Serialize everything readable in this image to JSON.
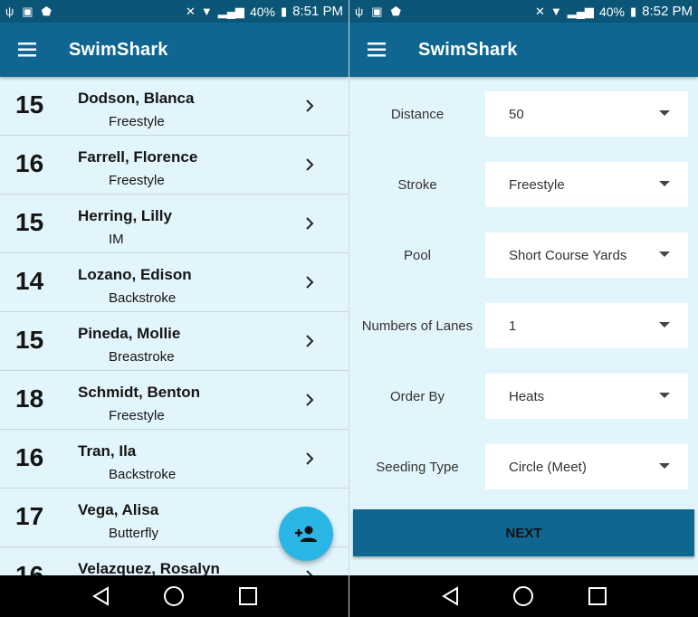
{
  "left": {
    "status": {
      "battery": "40%",
      "time": "8:51 PM"
    },
    "app_title": "SwimShark",
    "swimmers": [
      {
        "age": "15",
        "name": "Dodson, Blanca",
        "stroke": "Freestyle"
      },
      {
        "age": "16",
        "name": "Farrell, Florence",
        "stroke": "Freestyle"
      },
      {
        "age": "15",
        "name": "Herring, Lilly",
        "stroke": "IM"
      },
      {
        "age": "14",
        "name": "Lozano, Edison",
        "stroke": "Backstroke"
      },
      {
        "age": "15",
        "name": "Pineda, Mollie",
        "stroke": "Breastroke"
      },
      {
        "age": "18",
        "name": "Schmidt, Benton",
        "stroke": "Freestyle"
      },
      {
        "age": "16",
        "name": "Tran, Ila",
        "stroke": "Backstroke"
      },
      {
        "age": "17",
        "name": "Vega, Alisa",
        "stroke": "Butterfly"
      },
      {
        "age": "16",
        "name": "Velazquez, Rosalyn",
        "stroke": ""
      }
    ],
    "fab_icon": "add-person-icon"
  },
  "right": {
    "status": {
      "battery": "40%",
      "time": "8:52 PM"
    },
    "app_title": "SwimShark",
    "fields": [
      {
        "label": "Distance",
        "value": "50"
      },
      {
        "label": "Stroke",
        "value": "Freestyle"
      },
      {
        "label": "Pool",
        "value": "Short Course Yards"
      },
      {
        "label": "Numbers of Lanes",
        "value": "1"
      },
      {
        "label": "Order By",
        "value": "Heats"
      },
      {
        "label": "Seeding Type",
        "value": "Circle (Meet)"
      }
    ],
    "next_label": "NEXT"
  },
  "colors": {
    "app_bar": "#0f6691",
    "status_bar": "#0b5577",
    "background": "#e3f5fc",
    "fab": "#29b6e4"
  }
}
